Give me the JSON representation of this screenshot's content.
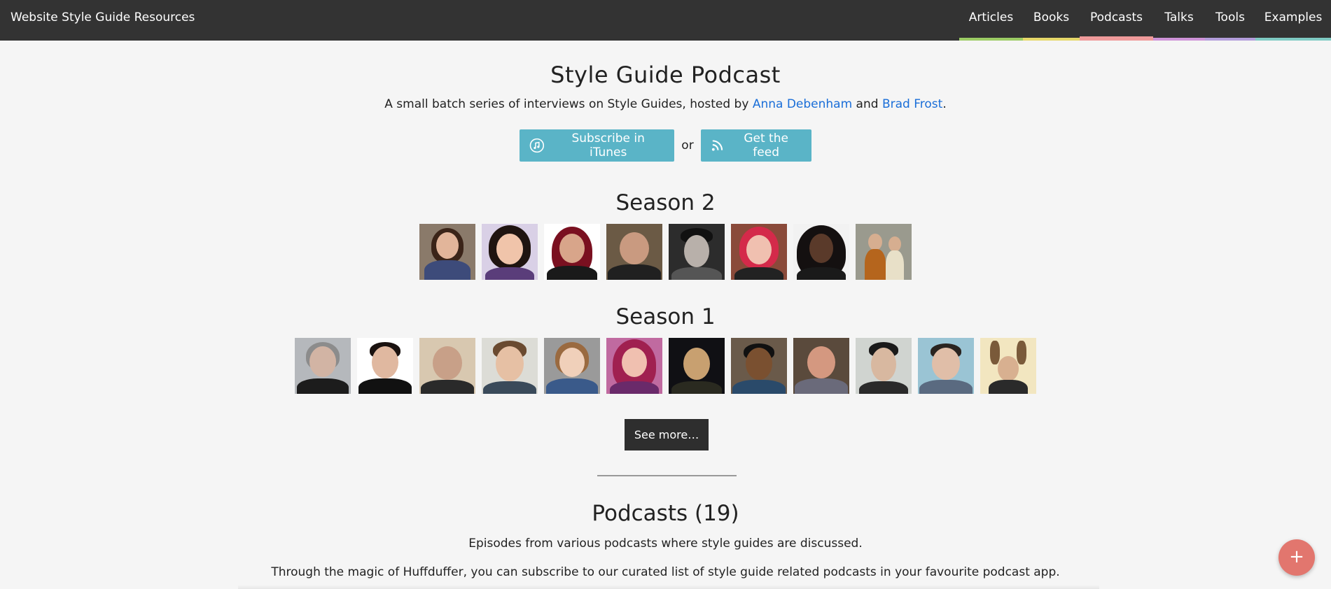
{
  "header": {
    "brand": "Website Style Guide Resources",
    "nav": [
      {
        "label": "Articles",
        "color": "#9ccc65",
        "active": false
      },
      {
        "label": "Books",
        "color": "#e6d86a",
        "active": false
      },
      {
        "label": "Podcasts",
        "color": "#ef9a9a",
        "active": true
      },
      {
        "label": "Talks",
        "color": "#ce93d8",
        "active": false
      },
      {
        "label": "Tools",
        "color": "#b39ddb",
        "active": false
      },
      {
        "label": "Examples",
        "color": "#80cbc4",
        "active": false
      }
    ]
  },
  "hero": {
    "title": "Style Guide Podcast",
    "intro_prefix": "A small batch series of interviews on Style Guides, hosted by ",
    "host1": "Anna Debenham",
    "intro_and": " and ",
    "host2": "Brad Frost",
    "intro_suffix": ".",
    "itunes_label": "Subscribe in iTunes",
    "itunes_icon": "music-note-icon",
    "or_text": "or",
    "feed_label": "Get the feed",
    "feed_icon": "rss-icon",
    "accent": "#5ab4c7"
  },
  "season2": {
    "title": "Season 2",
    "guests": 8
  },
  "season1": {
    "title": "Season 1",
    "guests": 12
  },
  "see_more_label": "See more…",
  "podcasts": {
    "title": "Podcasts (19)",
    "description": "Episodes from various podcasts where style guides are discussed.",
    "huffduffer": "Through the magic of Huffduffer, you can subscribe to our curated list of style guide related podcasts in your favourite podcast app."
  },
  "fab_icon": "plus-icon",
  "fab_label": "+"
}
